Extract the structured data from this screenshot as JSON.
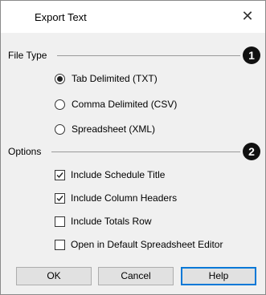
{
  "dialog": {
    "title": "Export Text",
    "close_glyph": "✕"
  },
  "file_type": {
    "label": "File Type",
    "badge": "1",
    "options": [
      {
        "label": "Tab Delimited (TXT)",
        "selected": true
      },
      {
        "label": "Comma Delimited (CSV)",
        "selected": false
      },
      {
        "label": "Spreadsheet (XML)",
        "selected": false
      }
    ]
  },
  "options": {
    "label": "Options",
    "badge": "2",
    "items": [
      {
        "label": "Include Schedule Title",
        "checked": true
      },
      {
        "label": "Include Column Headers",
        "checked": true
      },
      {
        "label": "Include Totals Row",
        "checked": false
      },
      {
        "label": "Open in Default Spreadsheet Editor",
        "checked": false
      }
    ]
  },
  "buttons": {
    "ok": "OK",
    "cancel": "Cancel",
    "help": "Help"
  }
}
